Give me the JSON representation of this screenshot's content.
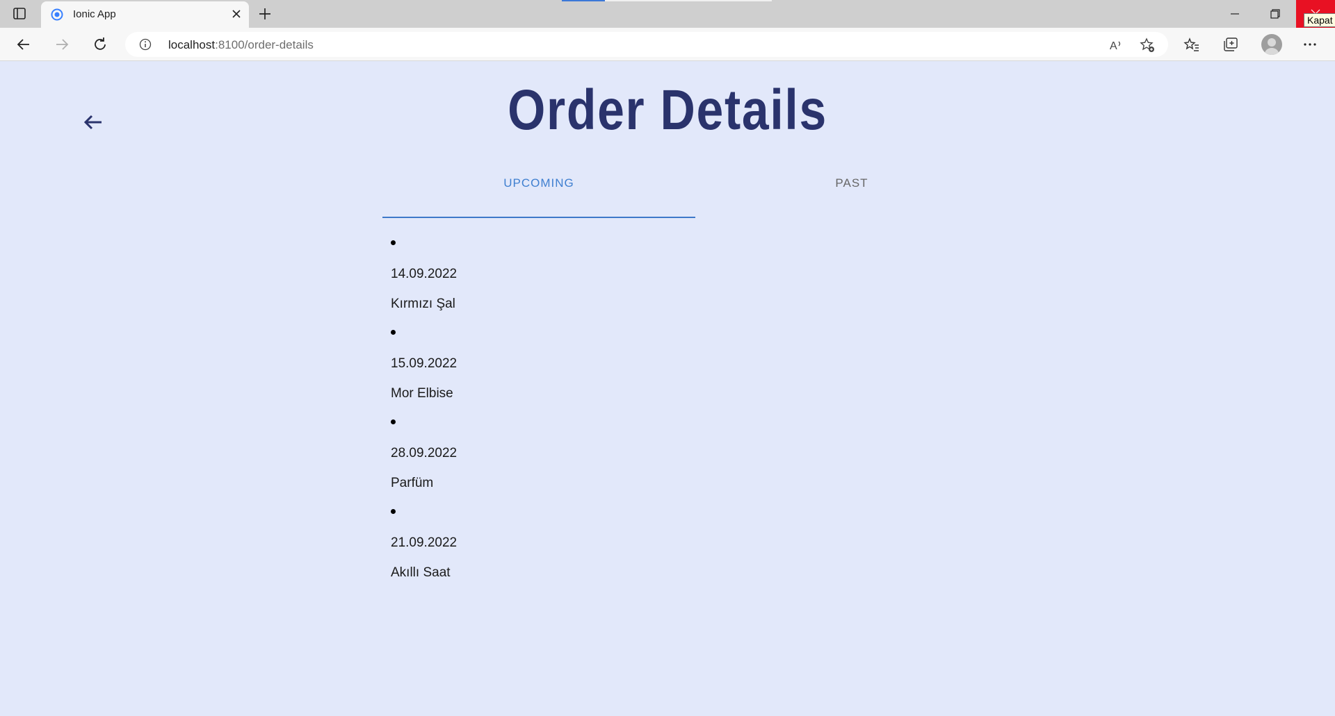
{
  "browser": {
    "tab_title": "Ionic App",
    "url_host": "localhost",
    "url_path": ":8100/order-details",
    "close_tooltip": "Kapat"
  },
  "icons": {
    "tab_actions": "tab-actions-icon",
    "favicon": "ionic-favicon-icon",
    "tab_close": "close-icon",
    "new_tab": "plus-icon",
    "back": "arrow-left-icon",
    "forward": "arrow-right-icon",
    "refresh": "refresh-icon",
    "site_info": "info-icon",
    "read_aloud": "read-aloud-icon",
    "add_favorite": "star-plus-icon",
    "favorites": "favorites-icon",
    "collections": "collections-icon",
    "profile": "avatar-icon",
    "more": "more-icon",
    "page_back": "arrow-left-icon"
  },
  "page": {
    "title": "Order Details",
    "tabs": [
      {
        "label": "UPCOMING",
        "selected": true
      },
      {
        "label": "PAST",
        "selected": false
      }
    ],
    "orders": [
      {
        "date": "14.09.2022",
        "name": "Kırmızı Şal"
      },
      {
        "date": "15.09.2022",
        "name": "Mor Elbise"
      },
      {
        "date": "28.09.2022",
        "name": "Parfüm"
      },
      {
        "date": "21.09.2022",
        "name": "Akıllı Saat"
      }
    ]
  },
  "colors": {
    "background": "#e2e8fa",
    "title": "#2a336c",
    "accent": "#3f7fd0",
    "inactive_tab": "#666666"
  }
}
